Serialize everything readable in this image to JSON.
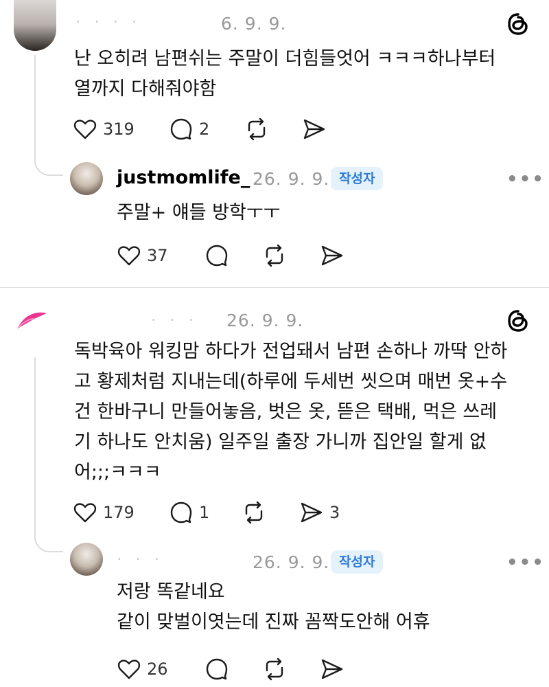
{
  "brand": {
    "logo_icon": "threads-logo-icon"
  },
  "post1": {
    "date": "6. 9. 9.",
    "lines": [
      "난 오히려 남편쉬는 주말이 더힘들엇어 ㅋㅋㅋ하나부터",
      "열까지 다해줘야함"
    ],
    "likes": "319",
    "replies": "2"
  },
  "reply1": {
    "username": "justmomlife_",
    "date": "26. 9. 9.",
    "badge": "작성자",
    "text": "주말+ 얘들 방학ㅜㅜ",
    "likes": "37",
    "more": "•••"
  },
  "post2": {
    "date": "26. 9. 9.",
    "lines": [
      "독박육아 워킹맘 하다가 전업돼서 남편 손하나 까딱 안하",
      "고 황제처럼 지내는데(하루에 두세번 씻으며 매번 옷+수",
      "건 한바구니 만들어놓음, 벗은 옷, 뜯은 택배, 먹은 쓰레",
      "기 하나도 안치움) 일주일 출장 가니까 집안일 할게 없",
      "어;;;ㅋㅋㅋ"
    ],
    "likes": "179",
    "replies": "1",
    "shares": "3"
  },
  "reply2": {
    "date": "26. 9. 9.",
    "badge": "작성자",
    "lines": [
      "저랑 똑같네요",
      "같이 맞벌이엿는데 진짜 꼼짝도안해 어휴"
    ],
    "likes": "26",
    "more": "•••"
  },
  "colors": {
    "accent_badge_bg": "#e5f2fc",
    "accent_badge_text": "#2e7bd6",
    "meta": "#999999"
  }
}
